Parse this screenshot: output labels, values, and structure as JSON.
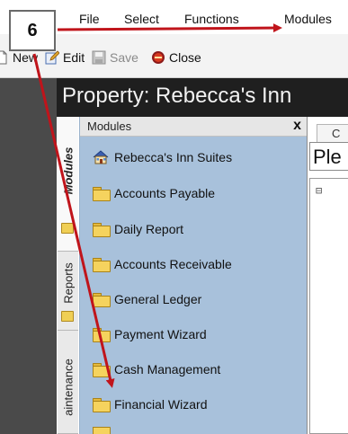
{
  "menu": {
    "items": [
      "File",
      "Select",
      "Functions",
      "Modules"
    ]
  },
  "toolbar": {
    "new_label": "New",
    "edit_label": "Edit",
    "save_label": "Save",
    "close_label": "Close"
  },
  "title": {
    "text": "Property: Rebecca's Inn"
  },
  "side_tabs": {
    "modules": "Modules",
    "reports": "Reports",
    "maintenance": "aintenance"
  },
  "modules_panel": {
    "title": "Modules",
    "close_symbol": "x",
    "items": [
      {
        "label": "Rebecca's Inn  Suites",
        "icon": "house-icon"
      },
      {
        "label": "Accounts Payable",
        "icon": "folder-icon"
      },
      {
        "label": "Daily Report",
        "icon": "folder-icon"
      },
      {
        "label": "Accounts Receivable",
        "icon": "folder-icon"
      },
      {
        "label": "General Ledger",
        "icon": "folder-icon"
      },
      {
        "label": "Payment Wizard",
        "icon": "folder-icon"
      },
      {
        "label": "Cash Management",
        "icon": "folder-icon"
      },
      {
        "label": "Financial Wizard",
        "icon": "folder-icon"
      }
    ]
  },
  "right_panel": {
    "tab_label": "C",
    "field_text": "Ple",
    "tree_toggle": "⊟"
  },
  "annotation": {
    "step_number": "6",
    "arrow_color": "#c0141b"
  },
  "colors": {
    "panel_bg": "#a8c1db",
    "title_bg": "#1f1f1f",
    "folder": "#f5d35e"
  }
}
